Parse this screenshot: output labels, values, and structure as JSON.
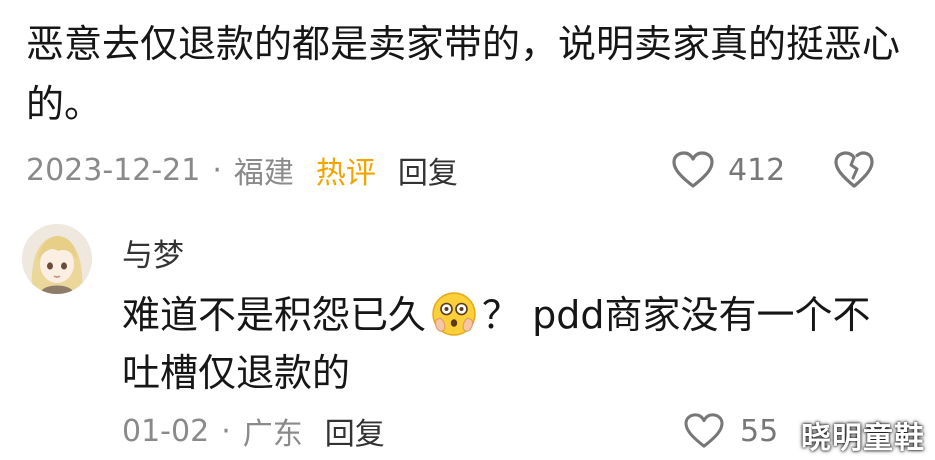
{
  "comment1": {
    "text": "恶意去仅退款的都是卖家带的，说明卖家真的挺恶心的。",
    "date": "2023-12-21",
    "separator": "·",
    "location": "福建",
    "hot_label": "热评",
    "reply_label": "回复",
    "like_count": "412",
    "like_icon": "heart-outline-icon",
    "dislike_icon": "broken-heart-icon"
  },
  "comment2": {
    "username": "与梦",
    "text_before_emoji": "难道不是积怨已久",
    "emoji": "flushed-face-emoji",
    "text_after_emoji": "？ pdd商家没有一个不吐槽仅退款的",
    "date": "01-02",
    "separator": "·",
    "location": "广东",
    "reply_label": "回复",
    "like_count": "55",
    "like_icon": "heart-outline-icon"
  },
  "watermark": "晓明童鞋",
  "colors": {
    "hot": "#f2a400",
    "meta": "#8a8a8a",
    "text": "#161616"
  }
}
